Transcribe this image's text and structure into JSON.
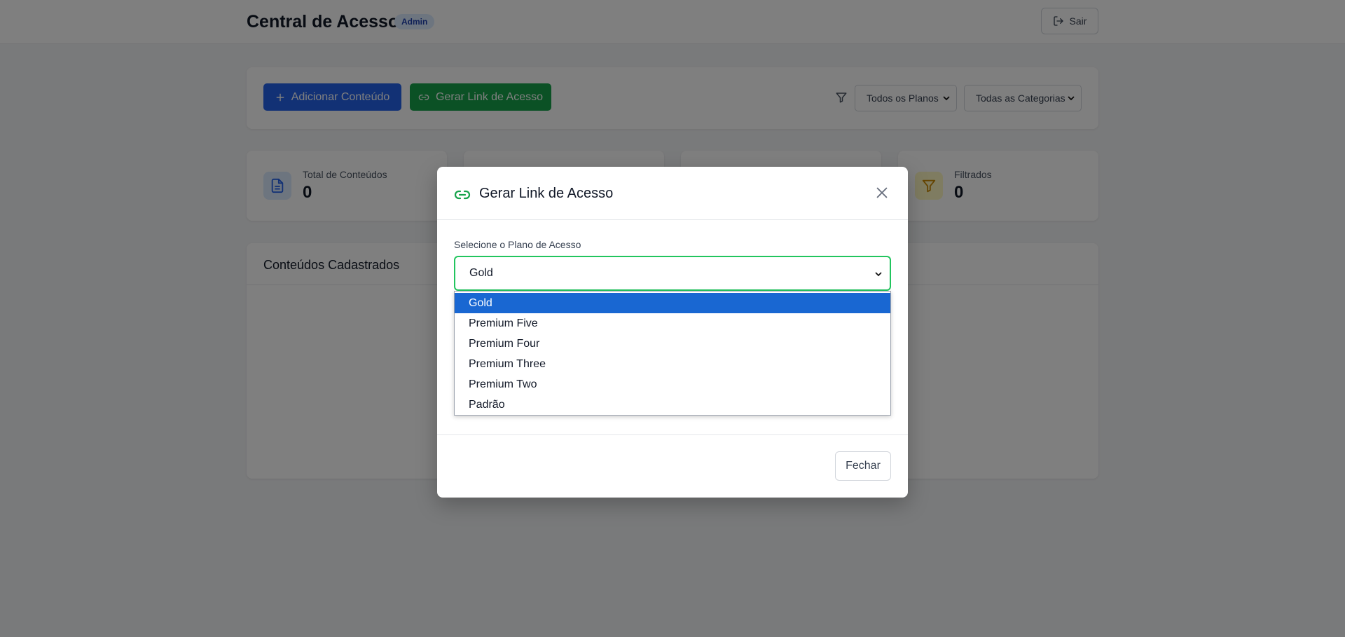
{
  "header": {
    "title": "Central de Acesso",
    "badge": "Admin",
    "logout_label": "Sair"
  },
  "toolbar": {
    "add_label": "Adicionar Conteúdo",
    "link_label": "Gerar Link de Acesso",
    "plans_filter": "Todos os Planos",
    "categories_filter": "Todas as Categorias"
  },
  "stats": [
    {
      "label": "Total de Conteúdos",
      "value": "0",
      "icon": "document-icon",
      "color": "#2563eb"
    },
    {
      "label": "",
      "value": "",
      "icon": "",
      "color": ""
    },
    {
      "label": "",
      "value": "",
      "icon": "",
      "color": ""
    },
    {
      "label": "Filtrados",
      "value": "0",
      "icon": "funnel-icon",
      "color": "#ca8a04"
    }
  ],
  "contents": {
    "title": "Conteúdos Cadastrados"
  },
  "modal": {
    "title": "Gerar Link de Acesso",
    "field_label": "Selecione o Plano de Acesso",
    "selected_plan": "Gold",
    "options": [
      "Gold",
      "Premium Five",
      "Premium Four",
      "Premium Three",
      "Premium Two",
      "Padrão"
    ],
    "close_label": "Fechar"
  },
  "colors": {
    "primary": "#2563eb",
    "success": "#16a34a",
    "focus": "#22c55e",
    "option_highlight": "#1967d2"
  }
}
